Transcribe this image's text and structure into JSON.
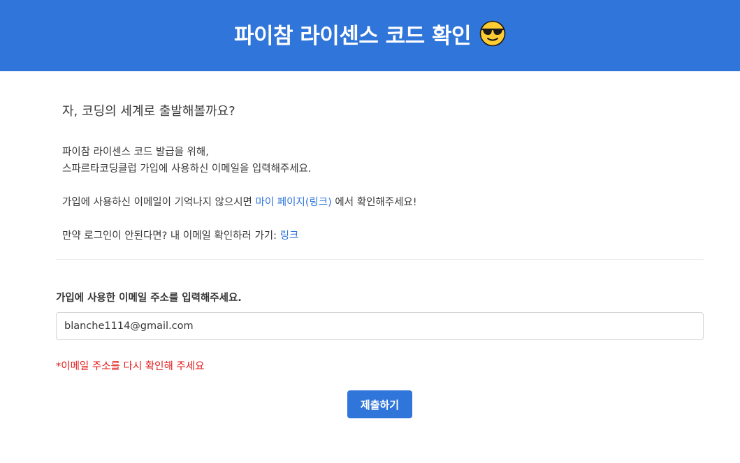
{
  "header": {
    "title": "파이참 라이센스 코드 확인",
    "emoji_icon": "sunglasses-face-icon"
  },
  "intro": {
    "greeting": "자, 코딩의 세계로 출발해볼까요?",
    "line1": "파이참 라이센스 코드 발급을 위해,",
    "line2": "스파르타코딩클럽 가입에 사용하신 이메일을 입력해주세요.",
    "mypage_prefix": "가입에 사용하신 이메일이 기억나지 않으시면 ",
    "mypage_link": "마이 페이지(링크)",
    "mypage_suffix": " 에서 확인해주세요!",
    "login_prefix": "만약 로그인이 안된다면? 내 이메일 확인하러 가기: ",
    "login_link": "링크"
  },
  "form": {
    "email_label": "가입에 사용한 이메일 주소를 입력해주세요.",
    "email_value": "blanche1114@gmail.com",
    "error_message": "*이메일 주소를 다시 확인해 주세요",
    "submit_label": "제출하기"
  },
  "colors": {
    "primary": "#3075d9",
    "error": "#e31b1b"
  }
}
